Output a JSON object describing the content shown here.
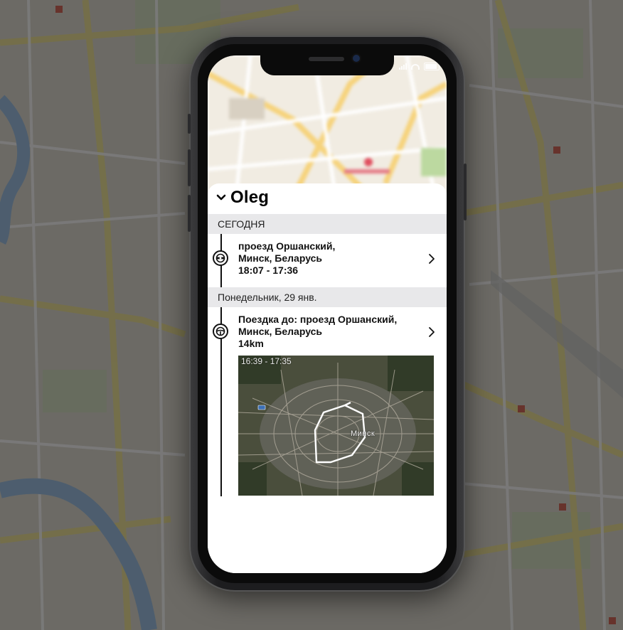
{
  "header": {
    "title": "Oleg"
  },
  "sections": [
    {
      "label": "СЕГОДНЯ",
      "trip": {
        "line1": "проезд Оршанский,",
        "line2": "Минск, Беларусь",
        "line3": "18:07 -  17:36"
      }
    },
    {
      "label": "Понедельник, 29 янв.",
      "trip": {
        "line1": "Поездка до: проезд Оршанский,",
        "line2": "Минск, Беларусь",
        "line3": "14km"
      },
      "map": {
        "time_range": "16:39 - 17:35",
        "city": "Минск"
      }
    }
  ],
  "icons": {
    "collapse": "chevron-down-icon",
    "open": "chevron-right-icon",
    "trip": "steering-wheel-icon"
  },
  "colors": {
    "section_bg": "#e8e8ea",
    "timeline": "#111111",
    "route": "#ffffff"
  }
}
